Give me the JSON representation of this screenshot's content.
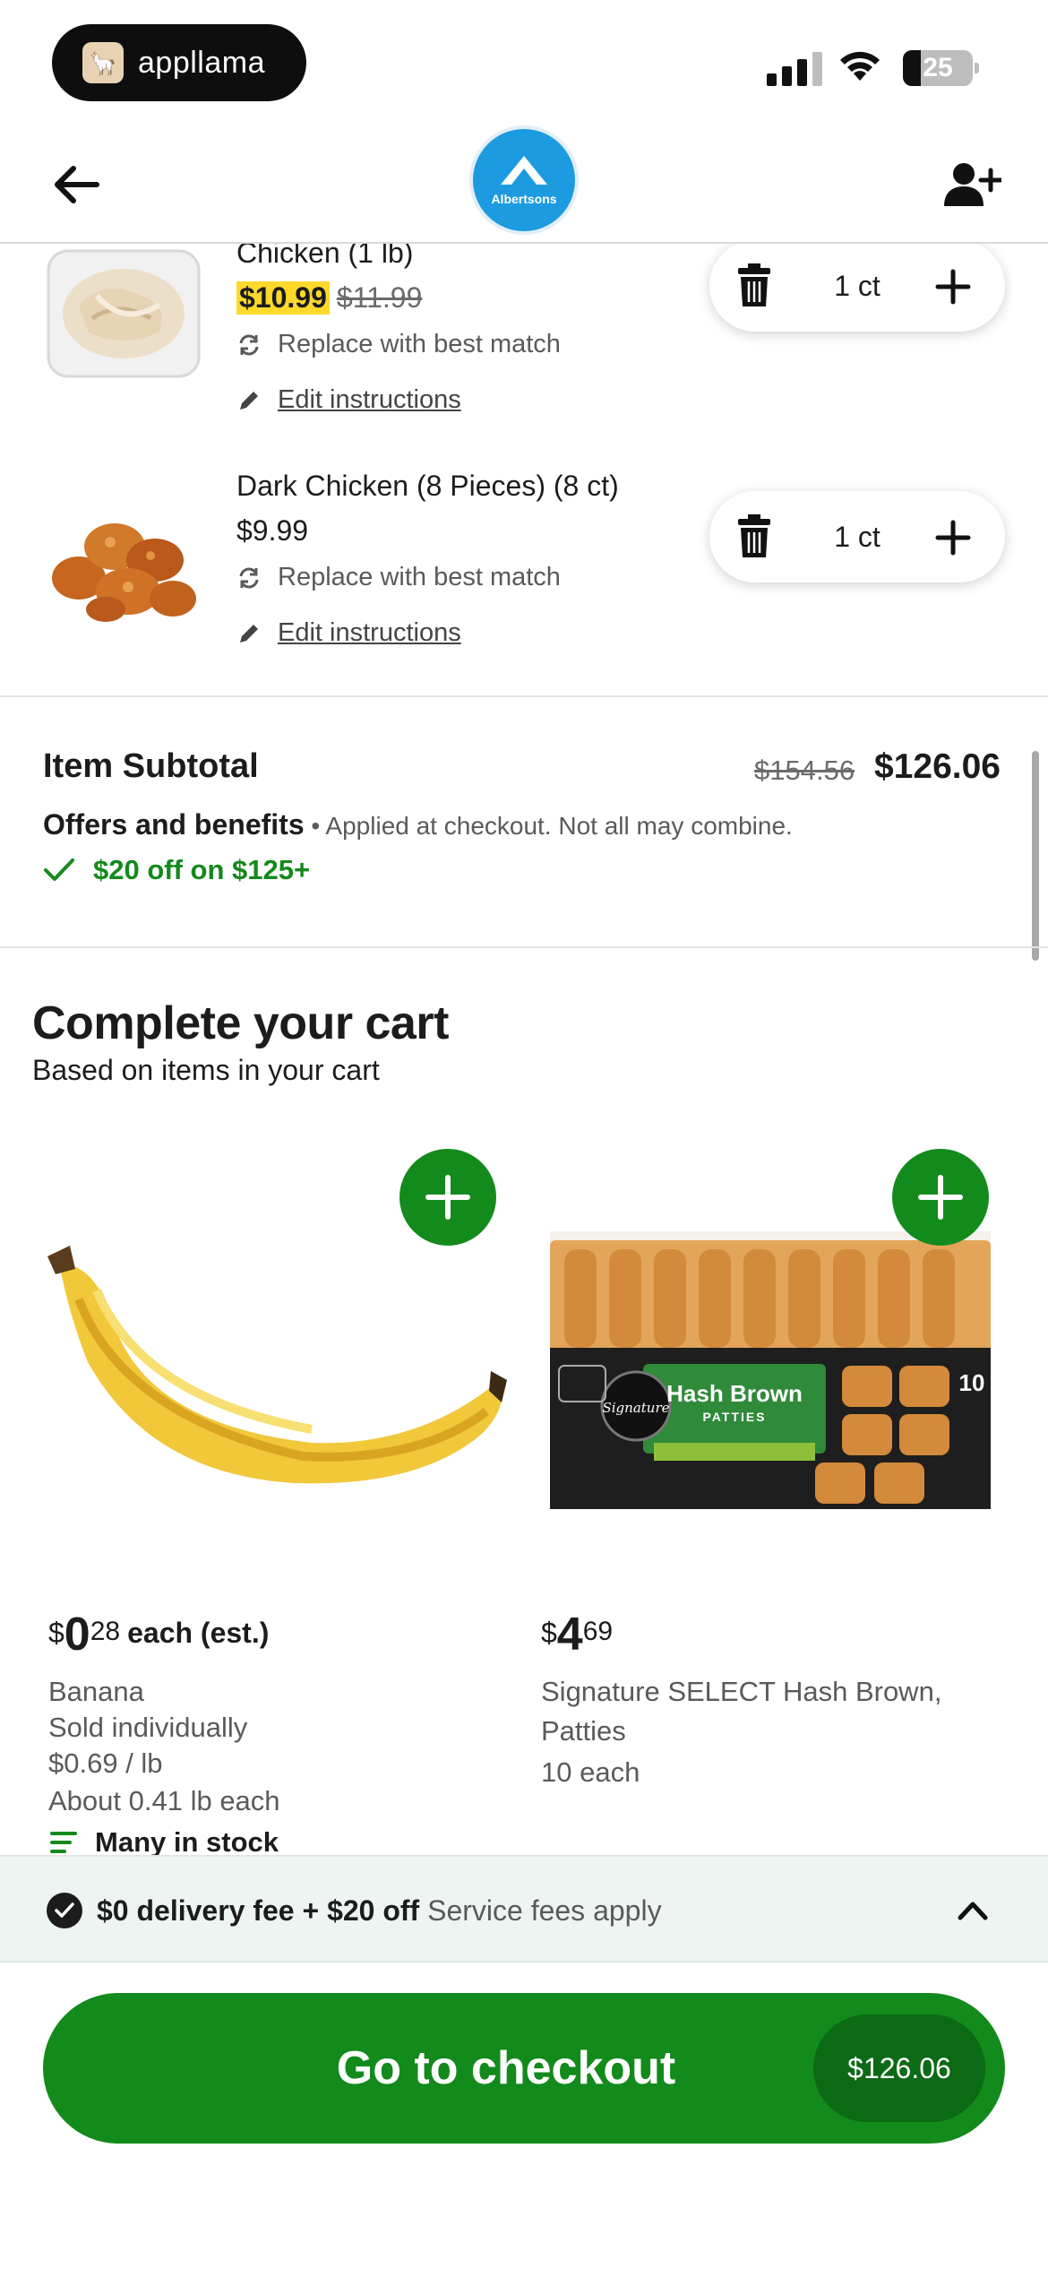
{
  "status_bar": {
    "app_name": "appllama",
    "battery": "25"
  },
  "header": {
    "store_logo_text": "Albertsons"
  },
  "cart_items": [
    {
      "name": "Chicken (1 lb)",
      "sale_price": "$10.99",
      "original_price": "$11.99",
      "replace_label": "Replace with best match",
      "edit_label": "Edit instructions",
      "quantity": "1 ct"
    },
    {
      "name": "Dark Chicken (8 Pieces) (8 ct)",
      "price": "$9.99",
      "replace_label": "Replace with best match",
      "edit_label": "Edit instructions",
      "quantity": "1 ct"
    }
  ],
  "subtotal": {
    "label": "Item Subtotal",
    "original": "$154.56",
    "value": "$126.06",
    "offers_label": "Offers and benefits",
    "offers_note": " • Applied at checkout. Not all may combine.",
    "promo": "$20 off on $125+"
  },
  "recommendations": {
    "title": "Complete your cart",
    "subtitle": "Based on items in your cart",
    "cards": [
      {
        "currency": "$",
        "dollars": "0",
        "cents": "28",
        "unit": "each (est.)",
        "name": "Banana",
        "line2": "Sold individually",
        "line3": "$0.69 / lb",
        "line4": "About 0.41 lb each",
        "line5": "Many in stock"
      },
      {
        "currency": "$",
        "dollars": "4",
        "cents": "69",
        "name_line1": "Signature SELECT Hash Brown,",
        "name_line2": "Patties",
        "line3": "10 each",
        "package_brand": "Signature SELECT",
        "package_title": "Hash Brown",
        "package_sub": "PATTIES",
        "package_count": "10"
      }
    ]
  },
  "promo_bar": {
    "bold": "$0 delivery fee + $20 off",
    "text": " Service fees apply"
  },
  "checkout": {
    "label": "Go to checkout",
    "total": "$126.06"
  },
  "colors": {
    "brand_green": "#138a1c",
    "albertsons_blue": "#1d9be0",
    "sale_highlight": "#fcd92b"
  }
}
